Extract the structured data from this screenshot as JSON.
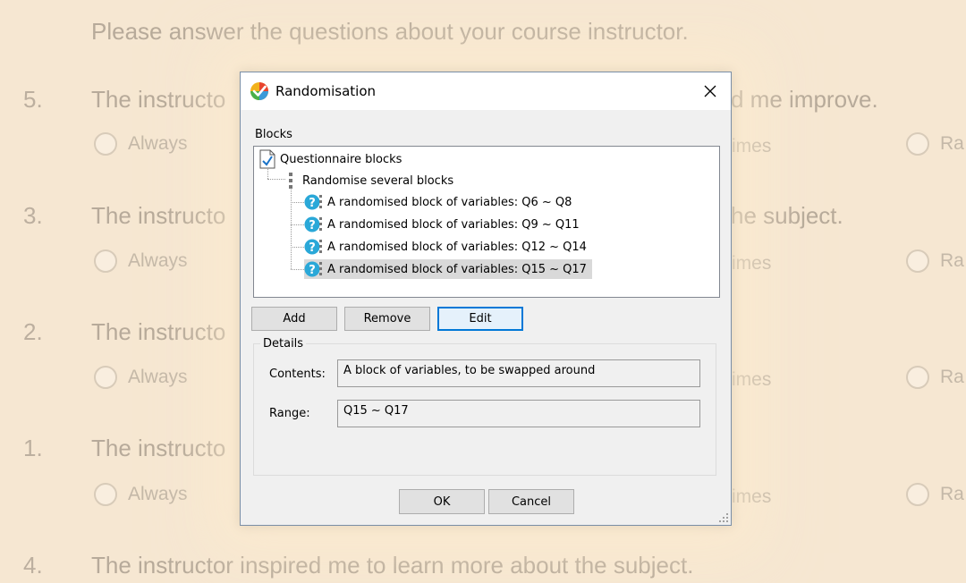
{
  "background": {
    "intro": "Please answer the questions about your course instructor.",
    "questions": [
      {
        "number": "5.",
        "text_left": "The instructo",
        "text_right": "d me improve.",
        "options": [
          "Always",
          "imes",
          "Ra"
        ]
      },
      {
        "number": "3.",
        "text_left": "The instructo",
        "text_right": "he subject.",
        "options": [
          "Always",
          "imes",
          "Ra"
        ]
      },
      {
        "number": "2.",
        "text_left": "The instructo",
        "text_right": "",
        "options": [
          "Always",
          "imes",
          "Ra"
        ]
      },
      {
        "number": "1.",
        "text_left": "The instructo",
        "text_right": "",
        "options": [
          "Always",
          "imes",
          "Ra"
        ]
      },
      {
        "number": "4.",
        "text_left": "The instructor inspired me to learn more about the subject.",
        "text_right": "",
        "options": []
      }
    ]
  },
  "dialog": {
    "title": "Randomisation",
    "close_glyph": "✕",
    "blocks_label": "Blocks",
    "tree": {
      "root": "Questionnaire blocks",
      "group": "Randomise several blocks",
      "items": [
        "A randomised block of variables: Q6 ~ Q8",
        "A randomised block of variables: Q9 ~ Q11",
        "A randomised block of variables: Q12 ~ Q14",
        "A randomised block of variables: Q15 ~ Q17"
      ],
      "selected_index": 3
    },
    "buttons": {
      "add": "Add",
      "remove": "Remove",
      "edit": "Edit",
      "ok": "OK",
      "cancel": "Cancel"
    },
    "details": {
      "legend": "Details",
      "contents_label": "Contents:",
      "contents_value": "A block of variables, to be swapped around",
      "range_label": "Range:",
      "range_value": "Q15 ~ Q17"
    }
  },
  "colors": {
    "page_background": "#f6e7d2",
    "dialog_background": "#f0f0f0",
    "selection": "#d9d9d9",
    "default_button_border": "#0078d7",
    "block_icon": "#2aa8d8"
  },
  "icons": {
    "app": "randomisation-app-icon",
    "root": "document-check-icon",
    "group": "randomise-group-icon",
    "item": "random-block-icon",
    "close": "close-icon",
    "grip": "resize-grip-icon"
  }
}
